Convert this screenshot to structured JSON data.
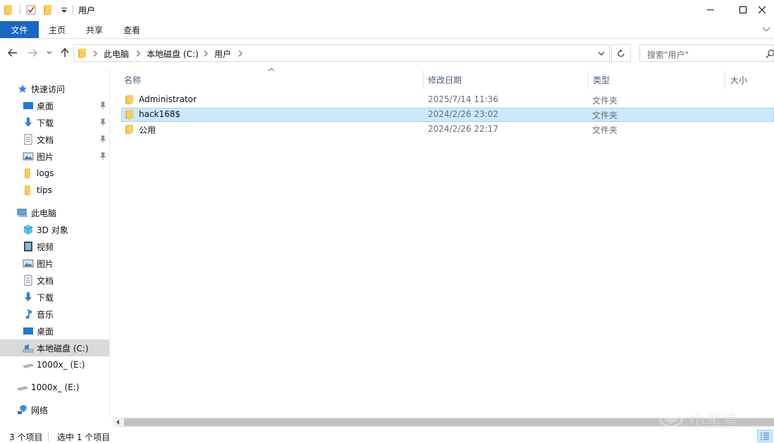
{
  "window": {
    "title": "用户",
    "controls": {
      "minimize": "minimize-icon",
      "maximize": "maximize-icon",
      "close": "close-icon"
    }
  },
  "ribbon": {
    "tabs": [
      {
        "label": "文件",
        "active": true
      },
      {
        "label": "主页"
      },
      {
        "label": "共享"
      },
      {
        "label": "查看"
      }
    ]
  },
  "address": {
    "crumbs": [
      "此电脑",
      "本地磁盘 (C:)",
      "用户"
    ],
    "search_placeholder": "搜索\"用户\""
  },
  "sidebar": {
    "items": [
      {
        "label": "快速访问",
        "icon": "star-icon"
      },
      {
        "label": "桌面",
        "icon": "desktop-icon",
        "pinned": true
      },
      {
        "label": "下载",
        "icon": "download-icon",
        "pinned": true
      },
      {
        "label": "文档",
        "icon": "document-icon",
        "pinned": true
      },
      {
        "label": "图片",
        "icon": "picture-icon",
        "pinned": true
      },
      {
        "label": "logs",
        "icon": "folder-icon"
      },
      {
        "label": "tips",
        "icon": "folder-icon"
      },
      {
        "label": "此电脑",
        "icon": "computer-icon"
      },
      {
        "label": "3D 对象",
        "icon": "3d-objects-icon"
      },
      {
        "label": "视频",
        "icon": "video-icon"
      },
      {
        "label": "图片",
        "icon": "picture-icon"
      },
      {
        "label": "文档",
        "icon": "document-icon"
      },
      {
        "label": "下载",
        "icon": "download-icon"
      },
      {
        "label": "音乐",
        "icon": "music-icon"
      },
      {
        "label": "桌面",
        "icon": "desktop-icon"
      },
      {
        "label": "本地磁盘 (C:)",
        "icon": "local-disk-icon",
        "selected": true
      },
      {
        "label": "1000x_ (E:)",
        "icon": "drive-icon"
      },
      {
        "label": "1000x_ (E:)",
        "icon": "drive-icon"
      },
      {
        "label": "网络",
        "icon": "network-icon"
      }
    ]
  },
  "columns": [
    "名称",
    "修改日期",
    "类型",
    "大小"
  ],
  "files": [
    {
      "name": "Administrator",
      "modified": "2025/7/14 11:36",
      "type": "文件夹"
    },
    {
      "name": "hack168$",
      "modified": "2024/2/26 23:02",
      "type": "文件夹",
      "selected": true
    },
    {
      "name": "公用",
      "modified": "2024/2/26 22:17",
      "type": "文件夹"
    }
  ],
  "status": {
    "item_count": "3 个项目",
    "selected_count": "选中 1 个项目"
  },
  "watermark": {
    "text": "小黑盒"
  },
  "colors": {
    "accent": "#1967c0",
    "selection_bg": "#cce8ff",
    "selection_border": "#99d1ff",
    "folder": "#f3c444",
    "sidebar_selected": "#d9d9d9"
  }
}
